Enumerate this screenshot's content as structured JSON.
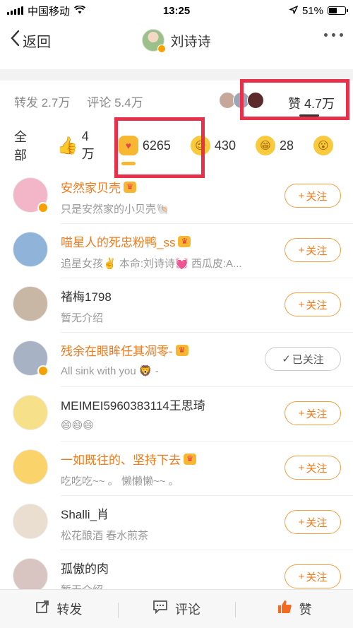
{
  "status_bar": {
    "carrier": "中国移动",
    "time": "13:25",
    "battery": "51%",
    "battery_level": 0.51
  },
  "nav": {
    "back_label": "返回",
    "title": "刘诗诗"
  },
  "stats": {
    "reposts": "转发 2.7万",
    "comments": "评论 5.4万",
    "likes_prefix": "赞",
    "likes_count": "4.7万"
  },
  "reaction_tabs": [
    {
      "label": "全部"
    },
    {
      "icon": "thumbs-up-icon",
      "count": "4万"
    },
    {
      "icon": "heart-icon",
      "count": "6265"
    },
    {
      "icon": "sleepy-face-icon",
      "count": "430"
    },
    {
      "icon": "grin-face-icon",
      "count": "28"
    },
    {
      "icon": "surprised-face-icon",
      "count": ""
    }
  ],
  "users": [
    {
      "name": "安然家贝壳",
      "vip": true,
      "verified": true,
      "bio": "只是安然家的小贝壳🐚",
      "follow": "关注",
      "followed": false,
      "avatar_color": "#f3b6c8"
    },
    {
      "name": "喵星人的死忠粉鸭_ss",
      "vip": true,
      "verified": false,
      "bio": "追星女孩✌️  本命:刘诗诗💓  西瓜皮:A...",
      "follow": "关注",
      "followed": false,
      "avatar_color": "#8fb3d9"
    },
    {
      "name": "褚梅1798",
      "vip": false,
      "verified": false,
      "bio": "暂无介绍",
      "follow": "关注",
      "followed": false,
      "avatar_color": "#c9b7a6"
    },
    {
      "name": "残余在眼眸任其凋零-",
      "vip": true,
      "verified": true,
      "bio": "All  sink  with  you 🦁 -",
      "follow": "已关注",
      "followed": true,
      "avatar_color": "#a7b3c4"
    },
    {
      "name": "MEIMEI5960383114王思琦",
      "vip": false,
      "verified": false,
      "bio": "😄😄😄",
      "follow": "关注",
      "followed": false,
      "avatar_color": "#f7e08a"
    },
    {
      "name": "一如既往的、坚持下去",
      "vip": true,
      "verified": false,
      "bio": "吃吃吃~~ 。 懒懒懒~~ 。",
      "follow": "关注",
      "followed": false,
      "avatar_color": "#fbd36b"
    },
    {
      "name": "Shalli_肖",
      "vip": false,
      "verified": false,
      "bio": "松花酿酒 春水煎茶",
      "follow": "关注",
      "followed": false,
      "avatar_color": "#e9ded0"
    },
    {
      "name": "孤傲的肉",
      "vip": false,
      "verified": false,
      "bio": "暂无介绍",
      "follow": "关注",
      "followed": false,
      "avatar_color": "#d8c4c0"
    }
  ],
  "bottom_bar": {
    "repost": "转发",
    "comment": "评论",
    "like": "赞"
  },
  "colors": {
    "accent": "#f27a1a",
    "highlight_box": "#e8304b"
  }
}
